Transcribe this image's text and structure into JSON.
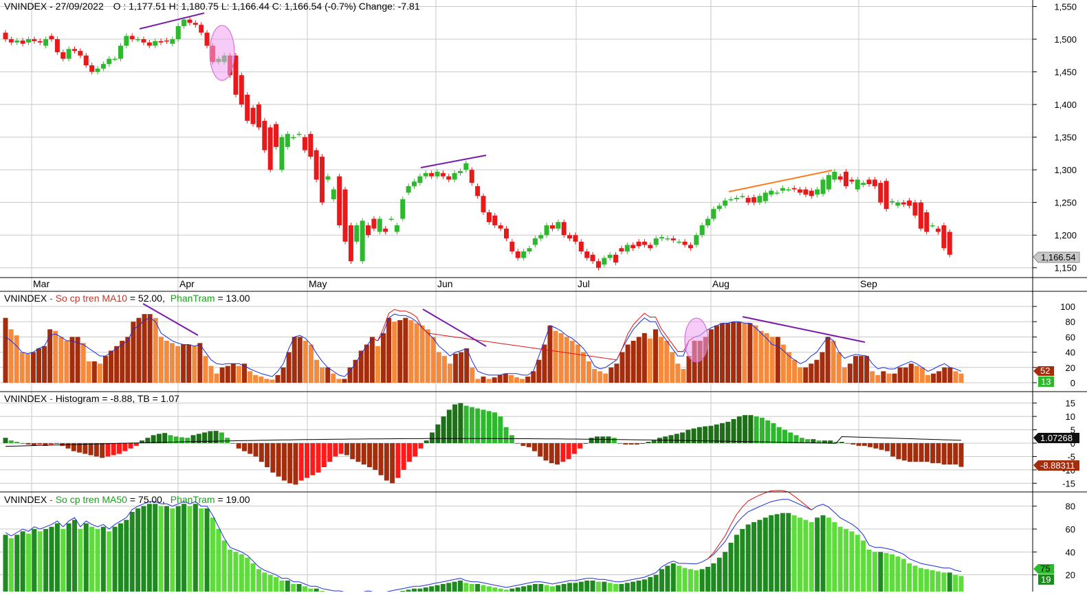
{
  "colors": {
    "up": "#2db82d",
    "down": "#e8191b",
    "grid": "#c8c8c8",
    "ma10_dark": "#a32d0c",
    "ma10_light": "#f58a3c",
    "hist_pos_dark": "#1f6e1a",
    "hist_pos_light": "#2db82d",
    "hist_neg_dark": "#a32d0c",
    "hist_neg_light": "#ff1a1a",
    "ma50_dark": "#1f8a1f",
    "ma50_light": "#5ddc3c",
    "blue_line": "#1a2edb",
    "red_line": "#e01010",
    "trend_purple": "#7a1aa8",
    "trend_orange": "#ff7a1a",
    "ellipse": "#f0a0f0"
  },
  "panels": {
    "price": {
      "title": "VNINDEX - 27/09/2022",
      "ohlc_text": "O : 1,177.51   H: 1,180.75   L: 1,166.44   C: 1,166.54   (-0.7%)   Change: -7.81",
      "last_value": "1,166.54"
    },
    "ma10": {
      "name": "VNINDEX",
      "sep": " - ",
      "label1": "So cp tren MA10",
      "value1": " = 52.00,",
      "label2": "PhanTram",
      "value2": " = 13.00",
      "badge1": "52",
      "badge2": "13"
    },
    "hist": {
      "name": "VNINDEX",
      "sep": " - ",
      "label1": "Histogram = -8.88,  TB = 1.07",
      "badge1": "1.07268",
      "badge2": "-8.88311"
    },
    "ma50": {
      "name": "VNINDEX",
      "sep": " - ",
      "label1": "So cp tren MA50",
      "value1": " = 75.00,",
      "label2": "PhanTram",
      "value2": " = 19.00",
      "badge1": "75",
      "badge2": "19"
    }
  },
  "chart_data": [
    {
      "type": "candlestick",
      "title": "VNINDEX - 27/09/2022",
      "x_months": [
        "Mar",
        "Apr",
        "May",
        "Jun",
        "Jul",
        "Aug",
        "Sep"
      ],
      "yticks": [
        1150,
        1200,
        1250,
        1300,
        1350,
        1400,
        1450,
        1500,
        1550
      ],
      "ylim": [
        1135,
        1560
      ],
      "open": [
        1510,
        1500,
        1495,
        1498,
        1495,
        1500,
        1497,
        1490,
        1505,
        1500,
        1480,
        1470,
        1485,
        1482,
        1475,
        1460,
        1450,
        1455,
        1462,
        1470,
        1470,
        1490,
        1505,
        1500,
        1500,
        1495,
        1490,
        1497,
        1498,
        1493,
        1500,
        1520,
        1530,
        1525,
        1522,
        1510,
        1490,
        1465,
        1465,
        1475,
        1475,
        1445,
        1415,
        1395,
        1400,
        1375,
        1365,
        1370,
        1300,
        1335,
        1350,
        1355,
        1350,
        1355,
        1330,
        1320,
        1285,
        1255,
        1290,
        1270,
        1215,
        1190,
        1160,
        1215,
        1225,
        1205,
        1210,
        1225,
        1205,
        1225,
        1265,
        1275,
        1280,
        1290,
        1295,
        1290,
        1295,
        1290,
        1285,
        1295,
        1300,
        1300,
        1275,
        1260,
        1235,
        1230,
        1215,
        1210,
        1190,
        1175,
        1165,
        1175,
        1185,
        1195,
        1200,
        1215,
        1210,
        1220,
        1200,
        1200,
        1190,
        1175,
        1170,
        1160,
        1155,
        1165,
        1170,
        1180,
        1175,
        1185,
        1190,
        1190,
        1185,
        1185,
        1195,
        1195,
        1195,
        1190,
        1190,
        1185,
        1185,
        1200,
        1215,
        1225,
        1240,
        1245,
        1255,
        1255,
        1260,
        1257,
        1258,
        1250,
        1252,
        1262,
        1265,
        1268,
        1270,
        1272,
        1270,
        1270,
        1268,
        1262,
        1263,
        1270,
        1285,
        1290,
        1297,
        1285,
        1270,
        1277,
        1285,
        1285,
        1280,
        1283,
        1250,
        1245,
        1250,
        1253,
        1250,
        1250,
        1235,
        1215,
        1210,
        1215,
        1205,
        1190,
        1180
      ],
      "close": [
        1500,
        1495,
        1498,
        1493,
        1500,
        1497,
        1495,
        1500,
        1500,
        1480,
        1470,
        1485,
        1482,
        1475,
        1460,
        1450,
        1455,
        1462,
        1470,
        1470,
        1490,
        1505,
        1500,
        1500,
        1495,
        1490,
        1497,
        1495,
        1497,
        1500,
        1520,
        1530,
        1525,
        1522,
        1510,
        1490,
        1465,
        1470,
        1475,
        1445,
        1415,
        1400,
        1375,
        1370,
        1365,
        1330,
        1300,
        1335,
        1350,
        1355,
        1350,
        1355,
        1330,
        1320,
        1285,
        1250,
        1290,
        1270,
        1215,
        1190,
        1160,
        1215,
        1222,
        1200,
        1210,
        1225,
        1205,
        1225,
        1215,
        1255,
        1275,
        1282,
        1290,
        1295,
        1290,
        1297,
        1290,
        1285,
        1295,
        1298,
        1310,
        1280,
        1260,
        1235,
        1220,
        1215,
        1210,
        1195,
        1175,
        1165,
        1175,
        1180,
        1195,
        1200,
        1215,
        1210,
        1220,
        1200,
        1195,
        1190,
        1175,
        1165,
        1160,
        1150,
        1165,
        1170,
        1158,
        1175,
        1185,
        1180,
        1183,
        1185,
        1180,
        1195,
        1197,
        1195,
        1192,
        1190,
        1185,
        1180,
        1200,
        1215,
        1225,
        1240,
        1245,
        1253,
        1255,
        1257,
        1260,
        1250,
        1250,
        1260,
        1265,
        1268,
        1265,
        1272,
        1270,
        1270,
        1265,
        1262,
        1260,
        1270,
        1285,
        1292,
        1297,
        1285,
        1275,
        1282,
        1285,
        1280,
        1278,
        1275,
        1250,
        1240,
        1252,
        1250,
        1247,
        1245,
        1230,
        1210,
        1205,
        1215,
        1205,
        1180,
        1170
      ],
      "high_low_note": "wicks approximated from candle ranges"
    },
    {
      "type": "bar",
      "title": "So cp tren MA10",
      "yticks": [
        0,
        20,
        40,
        60,
        80,
        100
      ],
      "ylim": [
        0,
        100
      ],
      "values": [
        85,
        70,
        62,
        40,
        38,
        40,
        45,
        48,
        70,
        68,
        60,
        55,
        60,
        60,
        52,
        28,
        28,
        25,
        35,
        42,
        48,
        55,
        60,
        80,
        85,
        90,
        90,
        85,
        60,
        55,
        52,
        48,
        50,
        50,
        48,
        52,
        35,
        22,
        12,
        20,
        22,
        25,
        22,
        25,
        15,
        10,
        8,
        5,
        4,
        10,
        20,
        40,
        60,
        60,
        55,
        50,
        30,
        20,
        20,
        12,
        5,
        5,
        20,
        30,
        42,
        50,
        60,
        48,
        65,
        85,
        80,
        82,
        85,
        82,
        78,
        75,
        70,
        60,
        40,
        35,
        25,
        38,
        40,
        45,
        20,
        5,
        8,
        5,
        7,
        10,
        12,
        10,
        7,
        5,
        8,
        15,
        30,
        50,
        75,
        68,
        65,
        60,
        55,
        50,
        40,
        28,
        18,
        15,
        12,
        20,
        25,
        40,
        50,
        55,
        60,
        65,
        58,
        70,
        60,
        55,
        40,
        25,
        18,
        35,
        55,
        55,
        60,
        70,
        75,
        78,
        78,
        80,
        80,
        78,
        78,
        75,
        68,
        65,
        60,
        60,
        50,
        40,
        30,
        20,
        20,
        25,
        30,
        40,
        60,
        55,
        40,
        20,
        25,
        35,
        35,
        35,
        15,
        10,
        15,
        12,
        12,
        20,
        20,
        25,
        22,
        20,
        10,
        12,
        15,
        20,
        20,
        15,
        12
      ],
      "line_blue": [
        60,
        55,
        48,
        40,
        38,
        40,
        45,
        48,
        62,
        64,
        60,
        55,
        55,
        52,
        50,
        45,
        40,
        35,
        35,
        40,
        45,
        50,
        55,
        70,
        75,
        82,
        85,
        80,
        65,
        60,
        55,
        52,
        50,
        50,
        48,
        50,
        40,
        30,
        25,
        24,
        25,
        25,
        25,
        22,
        18,
        15,
        12,
        10,
        8,
        15,
        25,
        45,
        60,
        62,
        58,
        50,
        38,
        28,
        20,
        15,
        10,
        8,
        15,
        25,
        38,
        48,
        58,
        55,
        65,
        85,
        90,
        88,
        88,
        85,
        80,
        72,
        65,
        58,
        48,
        42,
        35,
        40,
        42,
        45,
        28,
        15,
        12,
        10,
        10,
        10,
        12,
        12,
        12,
        10,
        10,
        15,
        35,
        55,
        75,
        72,
        68,
        62,
        58,
        52,
        45,
        35,
        22,
        18,
        20,
        25,
        30,
        45,
        58,
        70,
        78,
        85,
        80,
        80,
        65,
        55,
        45,
        35,
        35,
        55,
        60,
        62,
        68,
        72,
        75,
        78,
        78,
        80,
        80,
        78,
        78,
        72,
        65,
        58,
        50,
        48,
        42,
        35,
        30,
        25,
        28,
        35,
        40,
        50,
        60,
        55,
        40,
        32,
        35,
        37,
        36,
        35,
        25,
        18,
        20,
        18,
        18,
        22,
        25,
        28,
        25,
        20,
        15,
        18,
        22,
        25,
        20,
        18,
        15
      ],
      "line_red_note": "peaks above blue around Jun and Aug"
    },
    {
      "type": "bar",
      "title": "Histogram",
      "yticks": [
        -15,
        -10,
        -5,
        0,
        5,
        10,
        15
      ],
      "ylim": [
        -18,
        18
      ],
      "values": [
        2,
        1,
        0.5,
        0,
        -0.5,
        -1,
        -0.5,
        -1,
        -0.5,
        0,
        -1,
        -2,
        -3,
        -3.5,
        -4,
        -4.5,
        -5,
        -5.5,
        -5,
        -4.5,
        -4,
        -3,
        -2,
        -1,
        1,
        2,
        3,
        3.5,
        3.8,
        3,
        2.5,
        2.2,
        2,
        3,
        3.5,
        4,
        4.5,
        4.6,
        4,
        2,
        0,
        -2,
        -3,
        -4,
        -5,
        -7,
        -9,
        -11,
        -12.5,
        -14,
        -15,
        -15.5,
        -14,
        -13,
        -12,
        -11,
        -9,
        -7,
        -5,
        -4,
        -4.5,
        -6,
        -7,
        -8,
        -9,
        -10,
        -12,
        -14,
        -15,
        -13,
        -10,
        -7,
        -5,
        -2,
        1,
        4,
        7,
        10,
        12.5,
        14.5,
        15,
        14,
        13.5,
        13,
        12.5,
        12,
        11.5,
        10,
        6,
        3,
        0,
        -1,
        -1.5,
        -3,
        -5,
        -6.5,
        -7.5,
        -8,
        -7,
        -6,
        -4,
        -2,
        0,
        2,
        2.5,
        2.5,
        2.5,
        2,
        0,
        -0.5,
        -0.5,
        -0.5,
        0,
        0.5,
        1,
        2,
        2.5,
        3,
        3.5,
        4,
        5,
        5.5,
        6,
        6.3,
        6.5,
        7,
        7.5,
        8,
        9,
        10,
        10.5,
        10.5,
        10,
        9.5,
        8.5,
        7.5,
        6,
        5,
        4,
        3,
        2,
        1.5,
        1.5,
        1,
        1,
        1,
        0.5,
        0.5,
        0,
        -0.5,
        -1,
        -1,
        -1.5,
        -2,
        -2.5,
        -3,
        -5,
        -6,
        -6.5,
        -7,
        -7,
        -7,
        -7,
        -7.5,
        -7.5,
        -8,
        -8,
        -8,
        -8.88
      ],
      "tb_line_note": "signal line near 0, rising to ~2.5 then easing to 1.07"
    },
    {
      "type": "bar",
      "title": "So cp tren MA50",
      "yticks": [
        20,
        40,
        60,
        80
      ],
      "ylim": [
        0,
        90
      ],
      "values": [
        55,
        52,
        55,
        58,
        56,
        60,
        58,
        60,
        62,
        65,
        60,
        65,
        68,
        60,
        65,
        62,
        60,
        62,
        58,
        62,
        65,
        68,
        75,
        78,
        80,
        82,
        82,
        80,
        80,
        78,
        80,
        82,
        80,
        82,
        78,
        78,
        70,
        60,
        50,
        42,
        40,
        38,
        35,
        30,
        25,
        22,
        20,
        18,
        15,
        15,
        12,
        12,
        10,
        8,
        8,
        6,
        5,
        4,
        4,
        3,
        3,
        2,
        3,
        4,
        3,
        2,
        3,
        4,
        5,
        6,
        7,
        8,
        8,
        9,
        10,
        11,
        12,
        13,
        14,
        15,
        13,
        12,
        12,
        11,
        10,
        9,
        8,
        7,
        8,
        9,
        10,
        11,
        12,
        12,
        11,
        10,
        11,
        12,
        13,
        13,
        14,
        15,
        15,
        14,
        14,
        13,
        12,
        12,
        13,
        14,
        15,
        16,
        18,
        20,
        25,
        28,
        30,
        28,
        26,
        25,
        24,
        25,
        27,
        30,
        35,
        40,
        48,
        55,
        60,
        64,
        66,
        68,
        70,
        72,
        73,
        74,
        74,
        72,
        70,
        68,
        66,
        70,
        72,
        70,
        66,
        62,
        60,
        58,
        55,
        50,
        42,
        40,
        40,
        39,
        38,
        36,
        34,
        30,
        28,
        26,
        25,
        24,
        23,
        22,
        22,
        20,
        19
      ],
      "line_blue_note": "tracks bar tops, diverging high Aug–Sep"
    }
  ]
}
